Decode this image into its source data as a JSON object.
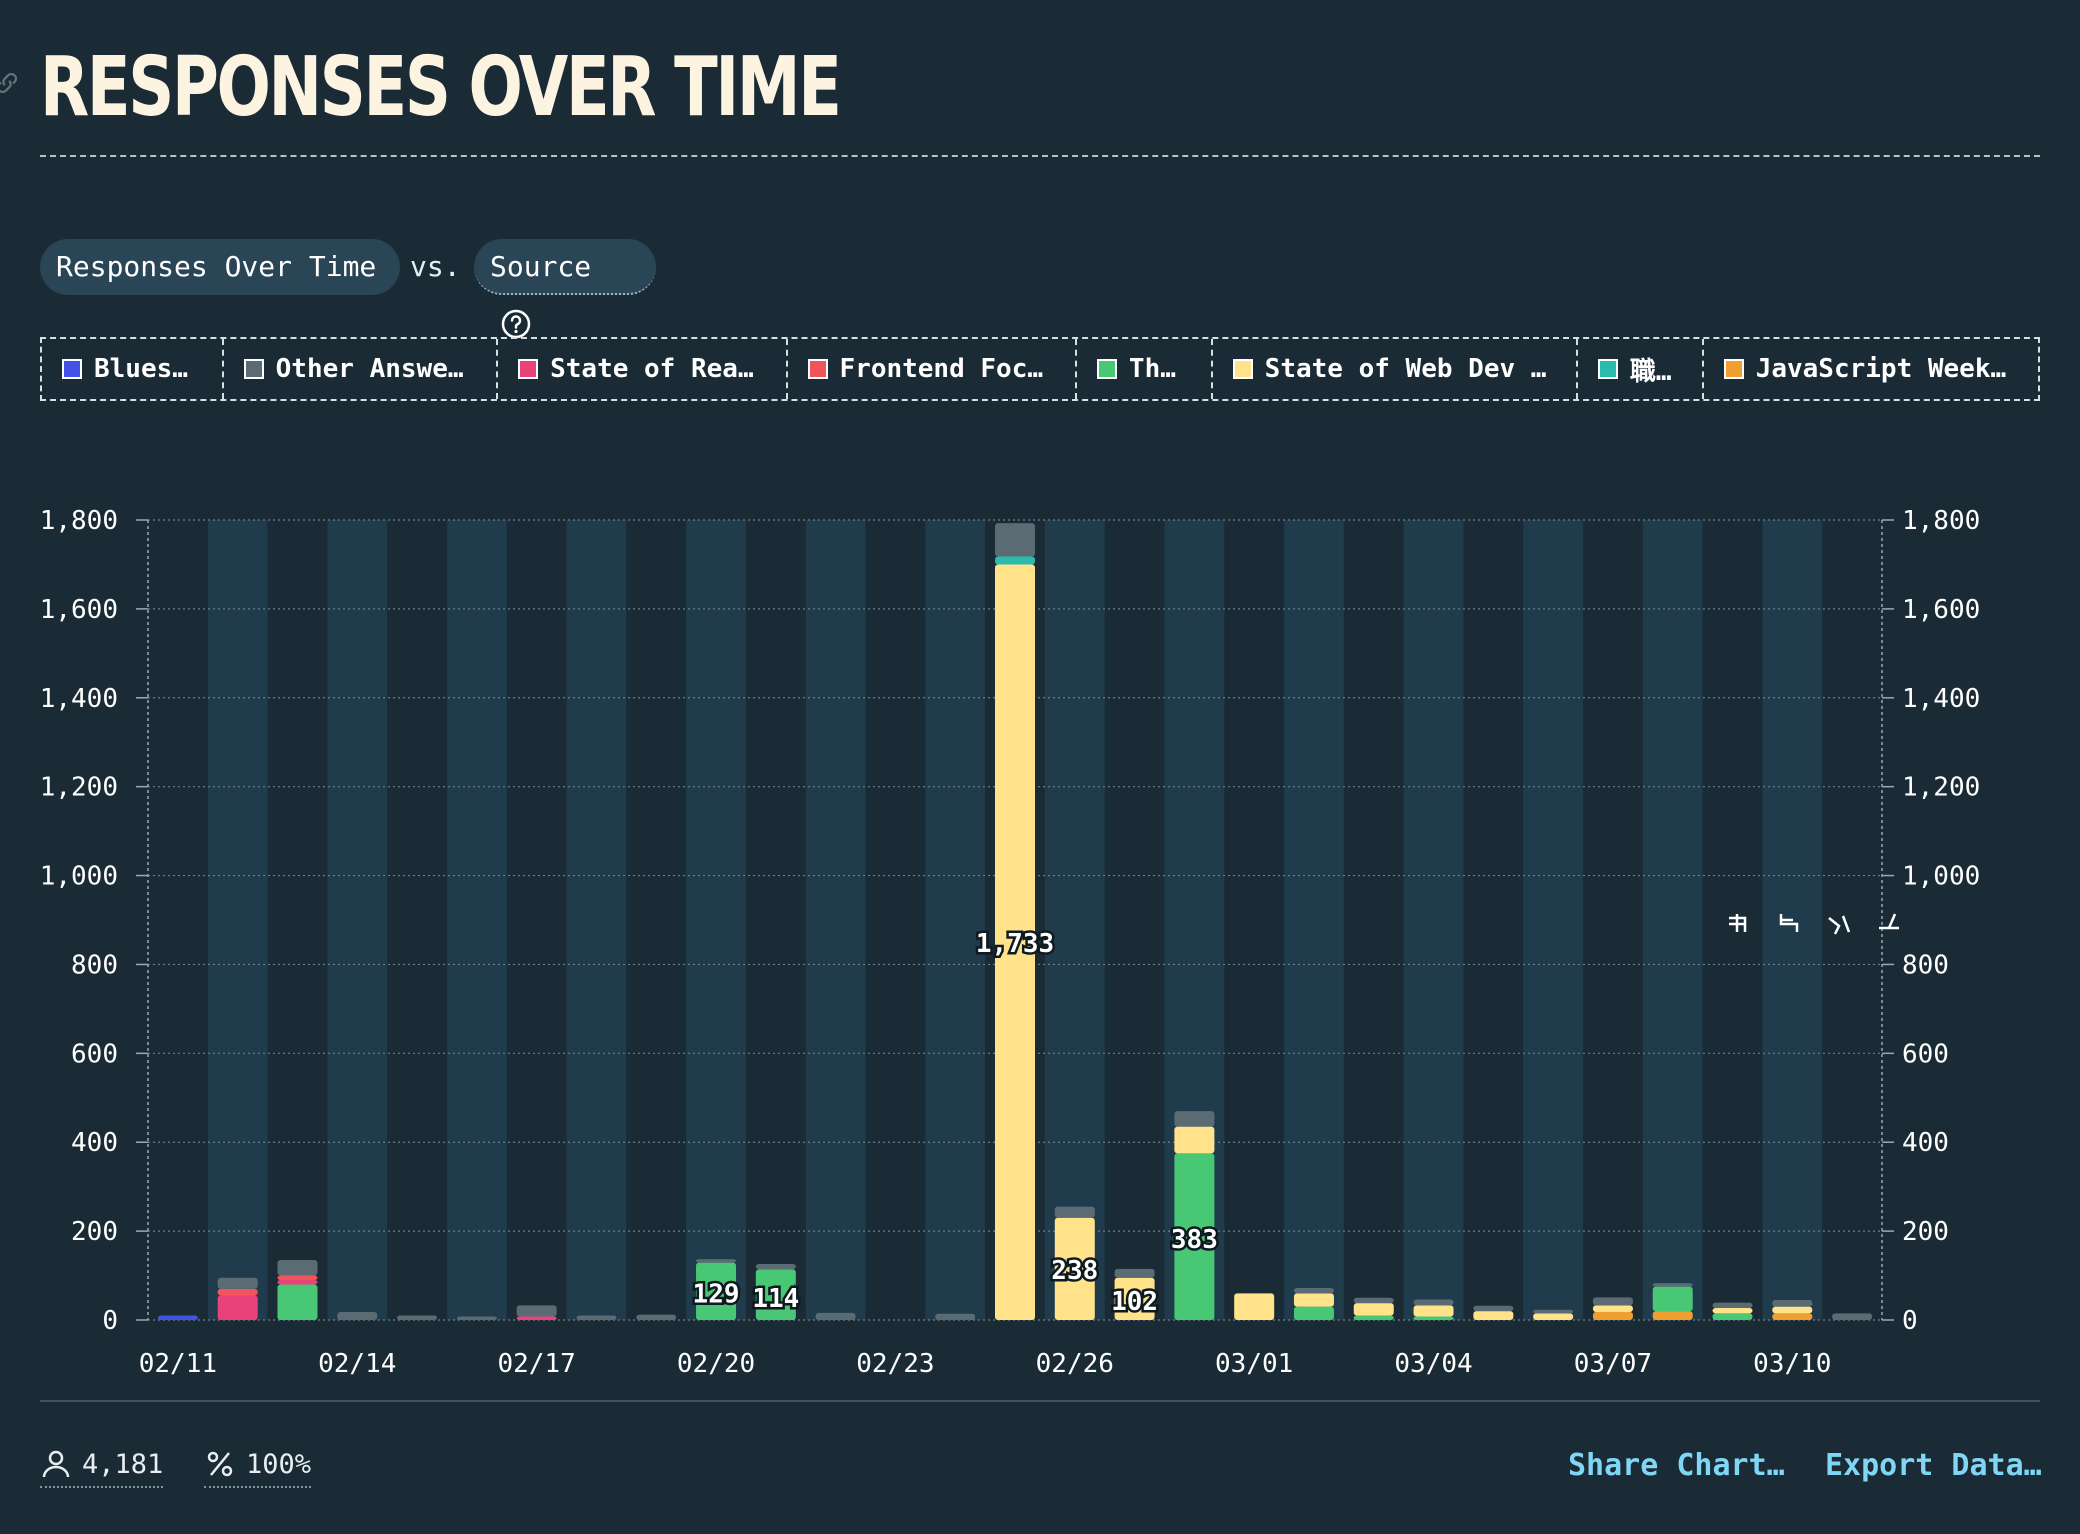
{
  "header": {
    "title": "RESPONSES OVER TIME",
    "link_icon": "link-icon"
  },
  "controls": {
    "metric_label": "Responses Over Time",
    "vs_label": "vs.",
    "source_label": "Source",
    "help_icon": "question-circle-icon"
  },
  "legend": [
    {
      "label": "Blues…",
      "color": "#4252e6"
    },
    {
      "label": "Other Answe…",
      "color": "#5b6b74"
    },
    {
      "label": "State of Rea…",
      "color": "#e9427a"
    },
    {
      "label": "Frontend Foc…",
      "color": "#f2545b"
    },
    {
      "label": "Th…",
      "color": "#48c774"
    },
    {
      "label": "State of Web Dev …",
      "color": "#ffe28a"
    },
    {
      "label": "職…",
      "color": "#2bbbad"
    },
    {
      "label": "JavaScript Week…",
      "color": "#f0a030"
    }
  ],
  "chart_data": {
    "type": "bar",
    "stacked": true,
    "ylim": [
      0,
      1800
    ],
    "y_ticks": [
      "0",
      "200",
      "400",
      "600",
      "800",
      "1,000",
      "1,200",
      "1,400",
      "1,600",
      "1,800"
    ],
    "x_ticks": [
      "02/11",
      "02/14",
      "02/17",
      "02/20",
      "02/23",
      "02/26",
      "03/01",
      "03/04",
      "03/07",
      "03/10"
    ],
    "categories": [
      "02/11",
      "02/12",
      "02/13",
      "02/14",
      "02/15",
      "02/16",
      "02/17",
      "02/18",
      "02/19",
      "02/20",
      "02/21",
      "02/22",
      "02/23",
      "02/24",
      "02/25",
      "02/26",
      "02/27",
      "02/28",
      "03/01",
      "03/02",
      "03/03",
      "03/04",
      "03/05",
      "03/06",
      "03/07",
      "03/08",
      "03/09",
      "03/10",
      "03/11"
    ],
    "series": [
      {
        "name": "JavaScript Week…",
        "color": "#f0a030",
        "values": [
          0,
          0,
          0,
          0,
          0,
          0,
          0,
          0,
          0,
          0,
          0,
          0,
          0,
          0,
          0,
          0,
          0,
          0,
          0,
          0,
          0,
          0,
          0,
          0,
          18,
          20,
          0,
          15,
          0
        ]
      },
      {
        "name": "Th…",
        "color": "#48c774",
        "values": [
          0,
          0,
          80,
          0,
          0,
          0,
          0,
          0,
          0,
          129,
          114,
          0,
          0,
          0,
          0,
          0,
          0,
          375,
          0,
          30,
          10,
          8,
          0,
          0,
          0,
          55,
          15,
          0,
          0
        ]
      },
      {
        "name": "State of Web Dev …",
        "color": "#ffe28a",
        "values": [
          0,
          0,
          0,
          0,
          0,
          0,
          0,
          0,
          0,
          0,
          0,
          0,
          0,
          0,
          1700,
          230,
          95,
          60,
          60,
          30,
          28,
          25,
          20,
          15,
          15,
          0,
          12,
          15,
          0
        ]
      },
      {
        "name": "State of Rea…",
        "color": "#e9427a",
        "values": [
          0,
          55,
          10,
          0,
          0,
          0,
          8,
          0,
          0,
          0,
          0,
          0,
          0,
          0,
          0,
          0,
          0,
          0,
          0,
          0,
          0,
          0,
          0,
          0,
          0,
          0,
          0,
          0,
          0
        ]
      },
      {
        "name": "Frontend Foc…",
        "color": "#f2545b",
        "values": [
          0,
          15,
          10,
          0,
          0,
          0,
          0,
          0,
          0,
          0,
          0,
          0,
          0,
          0,
          0,
          0,
          0,
          0,
          0,
          0,
          0,
          0,
          0,
          0,
          0,
          0,
          0,
          0,
          0
        ]
      },
      {
        "name": "Blues…",
        "color": "#4252e6",
        "values": [
          10,
          0,
          0,
          0,
          0,
          0,
          0,
          0,
          0,
          0,
          0,
          0,
          0,
          0,
          0,
          0,
          0,
          0,
          0,
          0,
          0,
          0,
          0,
          0,
          0,
          0,
          0,
          0,
          0
        ]
      },
      {
        "name": "職…",
        "color": "#2bbbad",
        "values": [
          0,
          0,
          0,
          0,
          0,
          0,
          0,
          0,
          0,
          0,
          0,
          0,
          0,
          0,
          18,
          0,
          0,
          0,
          0,
          0,
          0,
          0,
          0,
          0,
          0,
          0,
          0,
          0,
          0
        ]
      },
      {
        "name": "Other Answe…",
        "color": "#5b6b74",
        "values": [
          0,
          25,
          35,
          18,
          10,
          8,
          25,
          10,
          12,
          8,
          12,
          16,
          0,
          14,
          75,
          25,
          20,
          35,
          0,
          12,
          12,
          13,
          12,
          8,
          18,
          8,
          12,
          15,
          15
        ]
      }
    ],
    "bar_labels": [
      {
        "category": "02/20",
        "text": "129",
        "value": 62
      },
      {
        "category": "02/21",
        "text": "114",
        "value": 52
      },
      {
        "category": "02/25",
        "text": "1,733",
        "value": 850
      },
      {
        "category": "02/26",
        "text": "238",
        "value": 115
      },
      {
        "category": "02/27",
        "text": "102",
        "value": 45
      },
      {
        "category": "02/28",
        "text": "383",
        "value": 185
      }
    ]
  },
  "footer": {
    "respondents_icon": "person-icon",
    "respondents": "4,181",
    "percent_icon": "percent-icon",
    "percent": "100%",
    "share_label": "Share Chart…",
    "export_label": "Export Data…"
  }
}
